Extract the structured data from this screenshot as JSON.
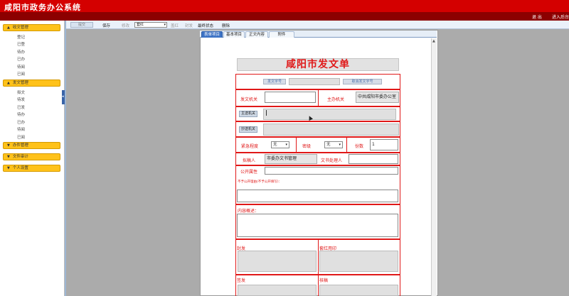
{
  "header": {
    "title": "咸阳市政务办公系统",
    "links": [
      "退 出",
      "进入后台"
    ]
  },
  "sidebar": {
    "sections": [
      {
        "label": "收文管理",
        "items": [
          "登记",
          "已登",
          "待办",
          "已办",
          "待阅",
          "已阅"
        ]
      },
      {
        "label": "发文管理",
        "items": [
          "拟文",
          "待发",
          "已发",
          "待办",
          "已办",
          "待阅",
          "已阅"
        ]
      },
      {
        "label": "办件管理",
        "items": []
      },
      {
        "label": "文件审计",
        "items": []
      },
      {
        "label": "个人设置",
        "items": []
      }
    ]
  },
  "toolbar": {
    "send_label": "提交",
    "save_label": "保存",
    "modify_label": "修改",
    "select_value": "套红",
    "stamp_label": "盖红",
    "seal_label": "封发",
    "final_status_label": "最终状态",
    "delete_label": "删除"
  },
  "tabs": [
    "表单项目",
    "基本项目",
    "正文内容",
    "附件"
  ],
  "form": {
    "title": "咸阳市发文单",
    "doc_number_button": "发文字号",
    "cancel_number_button": "取消发文字号",
    "issuing_org_label": "发文机关",
    "issuing_org_value": "",
    "host_org_label": "主办机关",
    "host_org_value": "中共咸阳市委办公室",
    "main_recipient_button": "主送机关",
    "main_recipient_value": "",
    "cc_button": "抄送机关",
    "urgency_label": "紧急程度",
    "urgency_value": "无",
    "secrecy_label": "密级",
    "secrecy_value": "无",
    "copies_label": "份数",
    "copies_value": "1",
    "drafter_label": "拟稿人",
    "drafter_value": "市委办文书管理",
    "handler_label": "文书处理人",
    "handler_value": "",
    "public_label": "公开属性",
    "public_value": "",
    "non_public_reason": "不予公开理由(不予公开填写)：",
    "summary_label": "内容概述：",
    "seal_issue_label": "封发",
    "stamp_label": "套红用印",
    "sign_label": "签发",
    "review_label": "核稿"
  }
}
